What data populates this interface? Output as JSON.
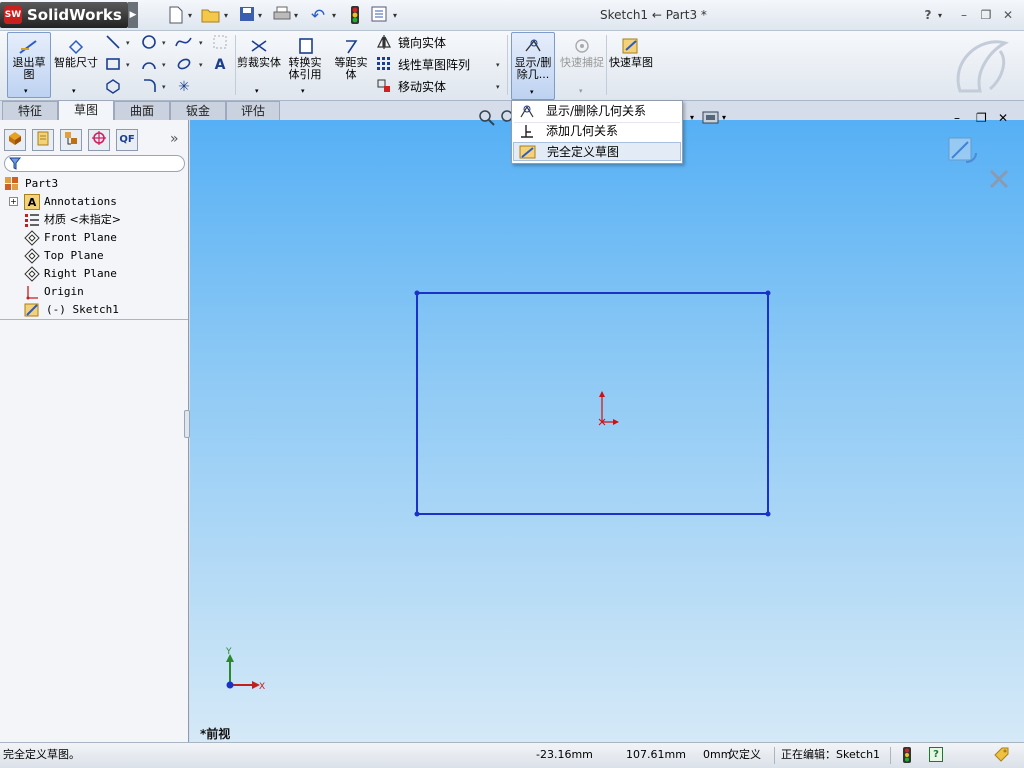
{
  "app": {
    "name": "SolidWorks",
    "badge": "SW"
  },
  "window": {
    "title": "Sketch1 ← Part3 *"
  },
  "quick_access": {
    "icons": [
      "new-icon",
      "open-icon",
      "save-icon",
      "print-icon",
      "undo-icon",
      "rebuild-icon",
      "options-icon"
    ]
  },
  "ribbon": {
    "exit_sketch": "退出草图",
    "smart_dimension": "智能尺寸",
    "trim": "剪裁实体",
    "convert": "转换实体引用",
    "offset": "等距实体",
    "mirror": "镜向实体",
    "linear_pattern": "线性草图阵列",
    "move": "移动实体",
    "display_relations": "显示/删除几...",
    "quick_snaps": "快速捕捉",
    "rapid_sketch": "快速草图"
  },
  "tabs": [
    "特征",
    "草图",
    "曲面",
    "钣金",
    "评估"
  ],
  "active_tab": "草图",
  "dropdown": {
    "items": [
      "显示/删除几何关系",
      "添加几何关系",
      "完全定义草图"
    ],
    "highlighted": "完全定义草图"
  },
  "panel_tabs": {
    "expand": "»",
    "qf": "QF"
  },
  "tree": {
    "root": "Part3",
    "items": [
      {
        "label": "Annotations",
        "icon": "annotations-icon"
      },
      {
        "label": "材质 <未指定>",
        "icon": "material-icon"
      },
      {
        "label": "Front Plane",
        "icon": "plane-icon"
      },
      {
        "label": "Top Plane",
        "icon": "plane-icon"
      },
      {
        "label": "Right Plane",
        "icon": "plane-icon"
      },
      {
        "label": "Origin",
        "icon": "origin-icon"
      },
      {
        "label": "(-) Sketch1",
        "icon": "sketch-icon"
      }
    ]
  },
  "viewport": {
    "view_name": "*前视",
    "triad": {
      "x": "X",
      "y": "Y"
    }
  },
  "status": {
    "message": "完全定义草图。",
    "x": "-23.16mm",
    "y": "107.61mm",
    "z": "0mm",
    "definition": "欠定义",
    "editing": "正在编辑：Sketch1"
  },
  "colors": {
    "sketch_line": "#1a32c8",
    "origin": "#d01010",
    "viewport_top": "#56b0f5",
    "viewport_bottom": "#d5e9f7"
  }
}
